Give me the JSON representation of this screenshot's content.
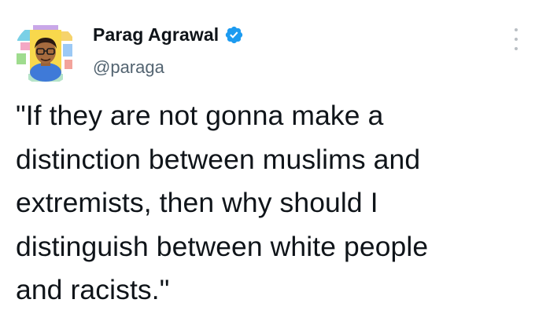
{
  "tweet": {
    "author": {
      "display_name": "Parag Agrawal",
      "handle": "@paraga",
      "verified_icon": "verified-badge-icon",
      "avatar_icon": "avatar-illustration"
    },
    "more_icon": "more-options-icon",
    "text": "\"If they are not gonna make a\ndistinction between muslims and\nextremists, then why should I\ndistinguish between white people\nand racists.\""
  },
  "colors": {
    "text_primary": "#0f1419",
    "text_secondary": "#536471",
    "verified_blue": "#1d9bf0",
    "background": "#ffffff"
  }
}
